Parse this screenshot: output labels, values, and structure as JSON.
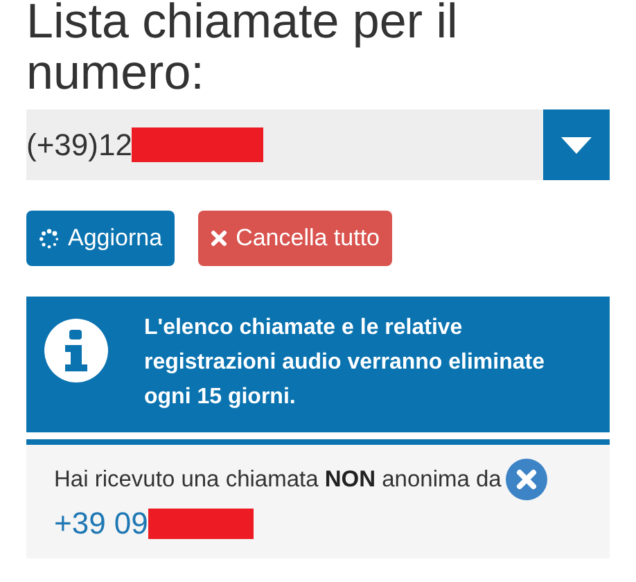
{
  "heading": "Lista chiamate per il numero:",
  "number_select": {
    "value": "(+39)12",
    "redacted": true
  },
  "buttons": [
    {
      "kind": "refresh",
      "label": "Aggiorna"
    },
    {
      "kind": "delete",
      "label": "Cancella tutto"
    }
  ],
  "info_alert": {
    "text": "L'elenco chiamate e le relative registrazioni audio verranno eliminate ogni 15 giorni."
  },
  "calls": [
    {
      "message": "Hai ricevuto una chiamata **NON** anonima da",
      "number": "+39 09",
      "redacted": true
    }
  ]
}
